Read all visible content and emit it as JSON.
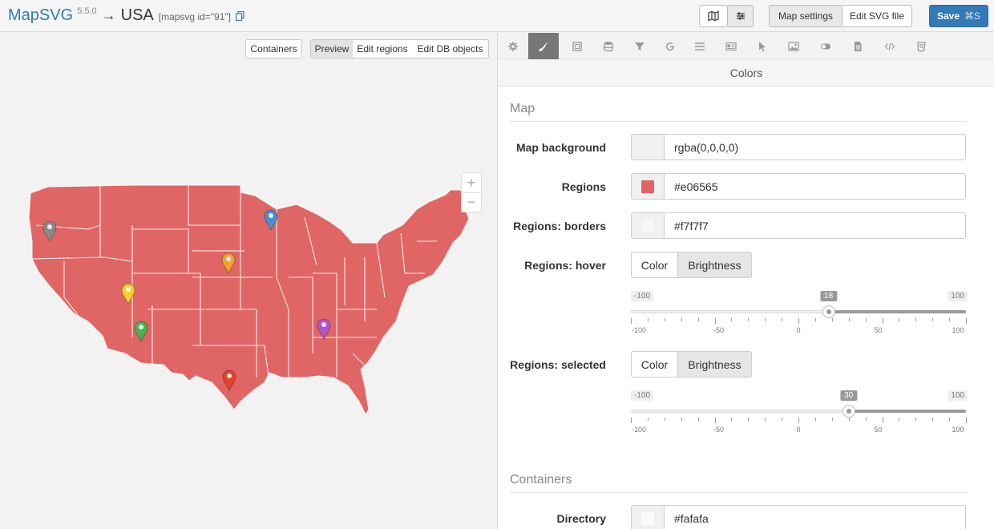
{
  "header": {
    "app_name": "MapSVG",
    "version": "5.5.0",
    "arrow": "→",
    "map_name": "USA",
    "shortcode": "[mapsvg id=\"91\"]",
    "map_settings_label": "Map settings",
    "edit_svg_label": "Edit SVG file",
    "save_label": "Save",
    "save_shortcut": "⌘S"
  },
  "left": {
    "containers_label": "Containers",
    "modes": [
      "Preview",
      "Edit regions",
      "Edit DB objects"
    ],
    "active_mode": "Preview",
    "zoom_in": "+",
    "zoom_out": "−",
    "markers": [
      {
        "color": "#8a8a8a"
      },
      {
        "color": "#4b8ec9"
      },
      {
        "color": "#f0a030"
      },
      {
        "color": "#f2cf2e"
      },
      {
        "color": "#4caf50"
      },
      {
        "color": "#b055c8"
      },
      {
        "color": "#e0442c"
      }
    ]
  },
  "right": {
    "tabs": [
      "settings",
      "colors",
      "regions",
      "database",
      "filters",
      "google",
      "directory",
      "details",
      "actions",
      "image",
      "toggle",
      "document",
      "code",
      "css"
    ],
    "active_tab": "colors",
    "section_title": "Colors",
    "groups": {
      "map": "Map",
      "containers": "Containers"
    },
    "fields": {
      "map_background": {
        "label": "Map background",
        "value": "rgba(0,0,0,0)",
        "swatch": "#f0f0f0"
      },
      "regions": {
        "label": "Regions",
        "value": "#e06565",
        "swatch": "#e06565"
      },
      "regions_borders": {
        "label": "Regions: borders",
        "value": "#f7f7f7",
        "swatch": "#f7f7f7"
      },
      "regions_hover": {
        "label": "Regions: hover",
        "options": [
          "Color",
          "Brightness"
        ],
        "selected": "Brightness",
        "min_label": "-100",
        "max_label": "100",
        "value": 18
      },
      "regions_selected": {
        "label": "Regions: selected",
        "options": [
          "Color",
          "Brightness"
        ],
        "selected": "Brightness",
        "min_label": "-100",
        "max_label": "100",
        "value": 30
      },
      "directory": {
        "label": "Directory",
        "value": "#fafafa",
        "swatch": "#fafafa"
      }
    },
    "scale_labels": [
      "-100",
      "-50",
      "0",
      "50",
      "100"
    ]
  },
  "colors": {
    "region_fill": "#e06565",
    "region_border": "#f7f7f7",
    "accent": "#337ab7"
  }
}
